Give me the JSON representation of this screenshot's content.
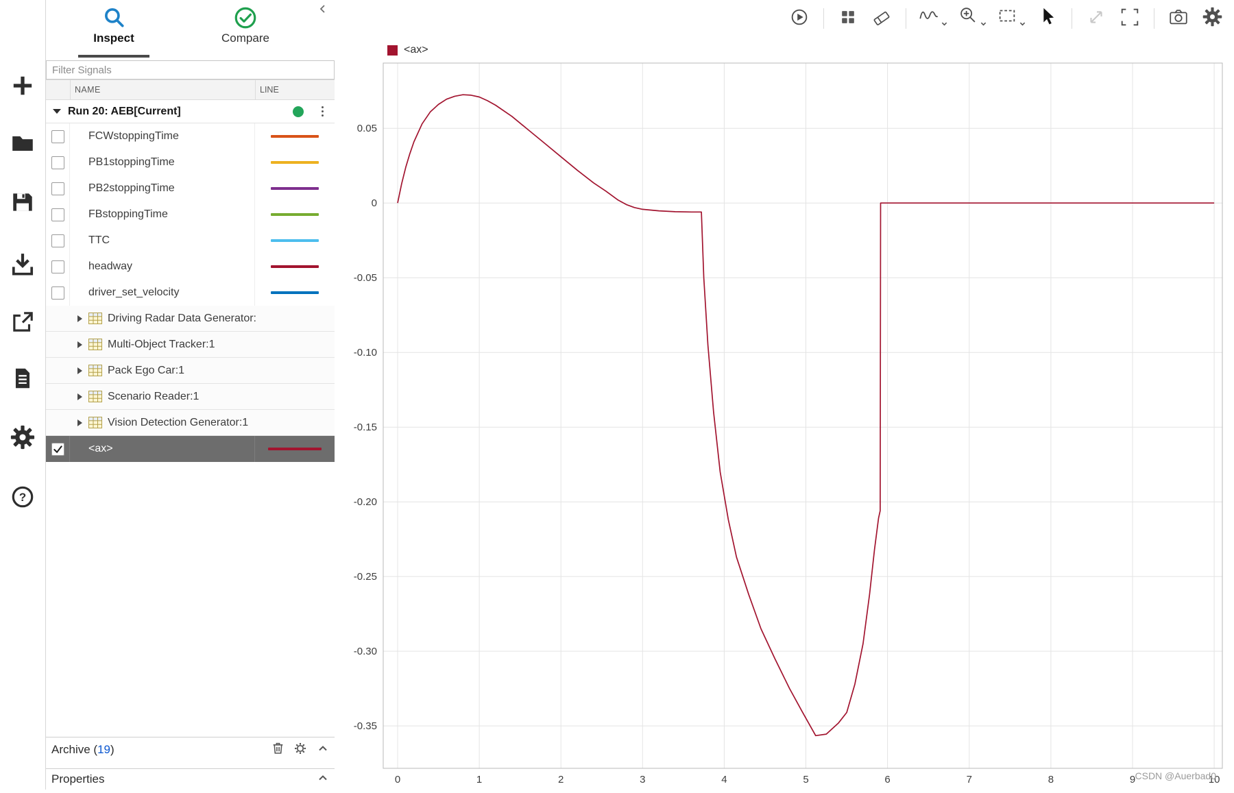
{
  "left_toolbar": {
    "icons": [
      "add",
      "open-folder",
      "save",
      "import",
      "export",
      "report",
      "settings",
      "help"
    ]
  },
  "panel": {
    "tabs": {
      "inspect": "Inspect",
      "compare": "Compare"
    },
    "filter_placeholder": "Filter Signals",
    "columns": {
      "name": "NAME",
      "line": "LINE"
    },
    "run": {
      "title": "Run 20: AEB[Current]",
      "status_color": "#23a55a"
    },
    "signals": [
      {
        "name": "FCWstoppingTime",
        "color": "#D95319"
      },
      {
        "name": "PB1stoppingTime",
        "color": "#EDB120"
      },
      {
        "name": "PB2stoppingTime",
        "color": "#7E2F8E"
      },
      {
        "name": "FBstoppingTime",
        "color": "#77AC30"
      },
      {
        "name": "TTC",
        "color": "#4DBEEE"
      },
      {
        "name": "headway",
        "color": "#A2142F"
      },
      {
        "name": "driver_set_velocity",
        "color": "#0072BD"
      }
    ],
    "groups": [
      {
        "name": "Driving Radar Data Generator:"
      },
      {
        "name": "Multi-Object Tracker:1"
      },
      {
        "name": "Pack Ego Car:1"
      },
      {
        "name": "Scenario Reader:1"
      },
      {
        "name": "Vision Detection Generator:1"
      }
    ],
    "selected": {
      "name": "<ax>",
      "color": "#A2142F",
      "checked": true
    },
    "archive": {
      "prefix": "Archive (",
      "count": "19",
      "suffix": ")"
    },
    "properties": "Properties"
  },
  "chart": {
    "toolbar_icons": [
      "play-circle",
      "layout-grid",
      "eraser",
      "signal-trace",
      "zoom-in",
      "zoom-region",
      "pointer",
      "pan-diagonal",
      "fit-to-view",
      "snapshot",
      "settings"
    ],
    "legend_label": "<ax>",
    "legend_color": "#A2142F",
    "watermark": "CSDN @Auerbad0"
  },
  "chart_data": {
    "type": "line",
    "title": "",
    "xlabel": "",
    "ylabel": "",
    "grid": true,
    "legend_position": "top-left",
    "xlim": [
      -0.176,
      10.1
    ],
    "ylim": [
      -0.3784,
      0.0937
    ],
    "xticks": [
      0,
      1,
      2,
      3,
      4,
      5,
      6,
      7,
      8,
      9,
      10
    ],
    "xtick_labels": [
      "0",
      "1",
      "2",
      "3",
      "4",
      "5",
      "6",
      "7",
      "8",
      "9",
      "10"
    ],
    "yticks": [
      0.05,
      0,
      -0.05,
      -0.1,
      -0.15,
      -0.2,
      -0.25,
      -0.3,
      -0.35
    ],
    "ytick_labels": [
      "0.05",
      "0",
      "-0.05",
      "-0.10",
      "-0.15",
      "-0.20",
      "-0.25",
      "-0.30",
      "-0.35"
    ],
    "series": [
      {
        "name": "<ax>",
        "color": "#A2142F",
        "x": [
          0,
          0.05,
          0.1,
          0.15,
          0.2,
          0.3,
          0.4,
          0.5,
          0.6,
          0.7,
          0.8,
          0.9,
          1.0,
          1.1,
          1.2,
          1.4,
          1.6,
          1.8,
          2.0,
          2.2,
          2.4,
          2.55,
          2.7,
          2.8,
          2.9,
          3.0,
          3.2,
          3.4,
          3.6,
          3.72,
          3.75,
          3.8,
          3.87,
          3.95,
          4.05,
          4.15,
          4.3,
          4.45,
          4.62,
          4.8,
          4.95,
          5.12,
          5.25,
          5.4,
          5.5,
          5.6,
          5.7,
          5.78,
          5.84,
          5.89,
          5.91,
          5.915,
          6.2,
          7,
          8,
          9,
          10
        ],
        "y": [
          0,
          0.013,
          0.024,
          0.033,
          0.041,
          0.053,
          0.061,
          0.066,
          0.0695,
          0.0715,
          0.0725,
          0.0722,
          0.071,
          0.0685,
          0.0655,
          0.058,
          0.049,
          0.04,
          0.031,
          0.022,
          0.0135,
          0.008,
          0.002,
          -0.001,
          -0.003,
          -0.0042,
          -0.0052,
          -0.0058,
          -0.006,
          -0.006,
          -0.05,
          -0.095,
          -0.14,
          -0.18,
          -0.212,
          -0.237,
          -0.262,
          -0.285,
          -0.305,
          -0.325,
          -0.34,
          -0.3565,
          -0.3555,
          -0.348,
          -0.341,
          -0.322,
          -0.295,
          -0.262,
          -0.232,
          -0.211,
          -0.206,
          0,
          0,
          0,
          0,
          0,
          0
        ]
      }
    ]
  }
}
